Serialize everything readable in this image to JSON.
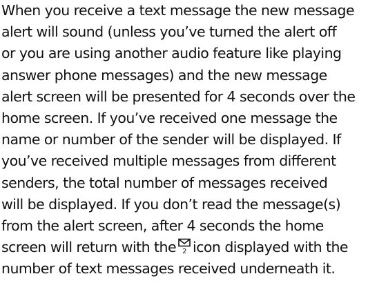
{
  "document": {
    "line_1": "When you receive a text message the new message",
    "line_2": "alert will sound (unless you’ve turned the alert off",
    "line_3": "or you are using another audio feature like playing",
    "line_4": "answer phone messages) and the new message",
    "line_5": "alert screen will be presented for 4 seconds over the",
    "line_6": "home screen. If you’ve received one message the",
    "line_7": "name or number of the sender will be displayed. If",
    "line_8": "you’ve received multiple messages from different",
    "line_9": "senders, the total number of messages received",
    "line_10": "will be displayed. If you don’t read the message(s)",
    "line_11": "from the alert screen, after 4 seconds the home",
    "line_12_before_icon": "screen will return with the",
    "line_12_after_icon": "icon displayed with the",
    "line_13": "number of text messages received underneath it."
  },
  "icon": {
    "name": "envelope-icon",
    "count": "2",
    "color": "#111111"
  }
}
